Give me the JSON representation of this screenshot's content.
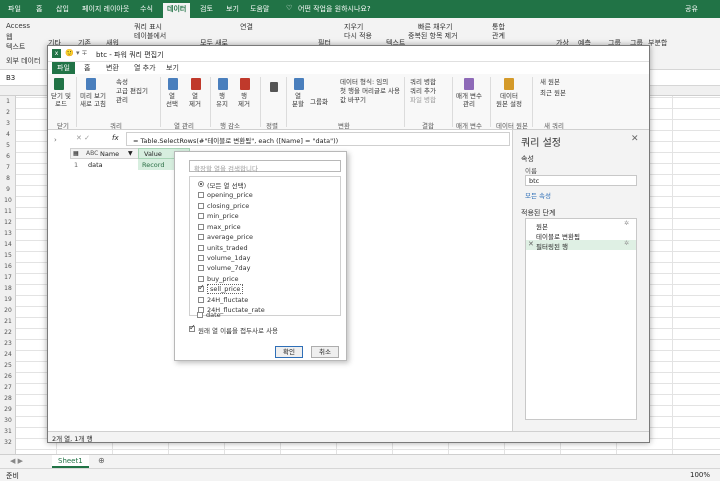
{
  "excel": {
    "tabs": [
      "파일",
      "홈",
      "삽입",
      "페이지 레이아웃",
      "수식",
      "데이터",
      "검토",
      "보기",
      "도움말"
    ],
    "active_tab": "데이터",
    "tell_me": "어떤 작업을 원하시나요?",
    "share": "공유",
    "ribbon_left": [
      "Access",
      "웹",
      "텍스트",
      "외부 데이터"
    ],
    "ribbon_labels": {
      "get": "기타",
      "existing": "기존",
      "new_query": "새워",
      "query_show": "쿼리 표시",
      "from_table": "테이블에서",
      "refresh_all": "모두 새로",
      "connections": "연결",
      "filter": "필터",
      "clear": "지우기",
      "reapply": "다시 적용",
      "text_col": "텍스트",
      "flash_fill": "빠른 채우기",
      "remove_dup": "중복된 항목 제거",
      "consolidate": "통합",
      "relations": "관계",
      "whatif": "가상",
      "forecast": "예측",
      "group": "그룹",
      "ungroup": "그룹",
      "subtotal": "부분합"
    },
    "name_box": "B3",
    "rows": [
      "1",
      "2",
      "3",
      "4",
      "5",
      "6",
      "7",
      "8",
      "9",
      "10",
      "11",
      "12",
      "13",
      "14",
      "15",
      "16",
      "17",
      "18",
      "19",
      "20",
      "21",
      "22",
      "23",
      "24",
      "25",
      "26",
      "27",
      "28",
      "29",
      "30",
      "31",
      "32"
    ],
    "sheet_tab": "Sheet1",
    "status_left": "준비",
    "zoom": "100%"
  },
  "pq": {
    "title": "btc - 파워 쿼리 편집기",
    "tabs": [
      "파일",
      "홈",
      "변환",
      "열 추가",
      "보기"
    ],
    "active_tab": "파일",
    "ribbon": {
      "close_load": "닫기 및\n로드",
      "refresh": "미리 보기\n새로 고침",
      "properties": "속성",
      "adv_editor": "고급 편집기",
      "manage": "관리",
      "choose_cols": "열\n선택",
      "remove_cols": "열\n제거",
      "keep_rows": "행\n유지",
      "remove_rows": "행\n제거",
      "sort": "",
      "split": "열\n분할",
      "group_by": "그룹화",
      "data_type": "데이터 형식: 임의",
      "first_row": "첫 행을 머리글로 사용",
      "replace": "값 바꾸기",
      "merge": "쿼리 병합",
      "append": "쿼리 추가",
      "combine": "파일 병합",
      "params": "매개 변수\n관리",
      "ds_settings": "데이터\n원본 설정",
      "new_source": "새 원본",
      "recent": "최근 원본",
      "groups": [
        "닫기",
        "쿼리",
        "열 관리",
        "행 감소",
        "정렬",
        "변환",
        "결합",
        "매개 변수",
        "데이터 원본",
        "새 쿼리"
      ]
    },
    "formula": "= Table.SelectRows(#\"테이블로 변환됨\", each ([Name] = \"data\"))",
    "fx": "fx",
    "table": {
      "col1": "Name",
      "col2": "Value",
      "row_num": "1",
      "cell1": "data",
      "cell2": "Record"
    },
    "status": "2개 열, 1개 행"
  },
  "settings": {
    "title": "쿼리 설정",
    "props": "속성",
    "name_label": "이름",
    "name_value": "btc",
    "all_props": "모든 속성",
    "steps_title": "적용된 단계",
    "steps": [
      "원본",
      "테이블로 변환됨",
      "필터링된 행"
    ]
  },
  "filter": {
    "search_placeholder": "확장할 열을 검색합니다",
    "items": [
      {
        "label": "(모든 열 선택)",
        "checked": false,
        "radio": true
      },
      {
        "label": "opening_price",
        "checked": false
      },
      {
        "label": "closing_price",
        "checked": false
      },
      {
        "label": "min_price",
        "checked": false
      },
      {
        "label": "max_price",
        "checked": false
      },
      {
        "label": "average_price",
        "checked": false
      },
      {
        "label": "units_traded",
        "checked": false
      },
      {
        "label": "volume_1day",
        "checked": false
      },
      {
        "label": "volume_7day",
        "checked": false
      },
      {
        "label": "buy_price",
        "checked": false
      },
      {
        "label": "sell_price",
        "checked": true
      },
      {
        "label": "24H_fluctate",
        "checked": false
      },
      {
        "label": "24H_fluctate_rate",
        "checked": false
      },
      {
        "label": "date",
        "checked": false
      }
    ],
    "prefix_option": "원래 열 이름을 접두사로 사용",
    "ok": "확인",
    "cancel": "취소"
  },
  "colors": {
    "excel_green": "#217346",
    "accent_blue": "#2f6fb7",
    "selected_step": "#dff0e4"
  }
}
